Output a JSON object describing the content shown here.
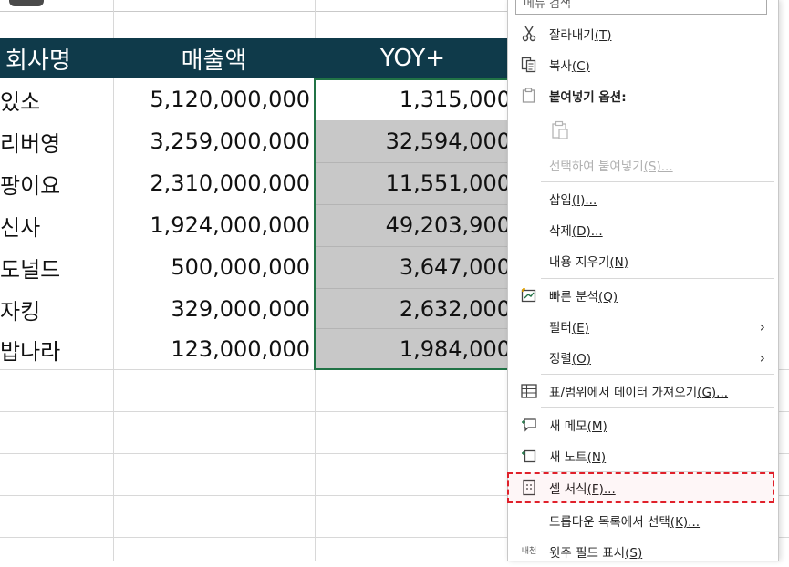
{
  "table": {
    "headers": [
      "회사명",
      "매출액",
      "YOY+"
    ],
    "rows": [
      {
        "name": "있소",
        "sales": "5,120,000,000",
        "yoy": "1,315,000"
      },
      {
        "name": "리버영",
        "sales": "3,259,000,000",
        "yoy": "32,594,000"
      },
      {
        "name": "팡이요",
        "sales": "2,310,000,000",
        "yoy": "11,551,000"
      },
      {
        "name": "신사",
        "sales": "1,924,000,000",
        "yoy": "49,203,900"
      },
      {
        "name": "도널드",
        "sales": "500,000,000",
        "yoy": "3,647,000"
      },
      {
        "name": "자킹",
        "sales": "329,000,000",
        "yoy": "2,632,000"
      },
      {
        "name": "밥나라",
        "sales": "123,000,000",
        "yoy": "1,984,000"
      }
    ]
  },
  "context_menu": {
    "search_placeholder": "메뉴 검색",
    "items": {
      "cut": {
        "label": "잘라내기",
        "key": "(T)"
      },
      "copy": {
        "label": "복사",
        "key": "(C)"
      },
      "paste_options": {
        "label": "붙여넣기 옵션:"
      },
      "paste_special": {
        "label": "선택하여 붙여넣기",
        "key": "(S)..."
      },
      "insert": {
        "label": "삽입",
        "key": "(I)..."
      },
      "delete": {
        "label": "삭제",
        "key": "(D)..."
      },
      "clear": {
        "label": "내용 지우기",
        "key": "(N)"
      },
      "quick_analysis": {
        "label": "빠른 분석",
        "key": "(Q)"
      },
      "filter": {
        "label": "필터",
        "key": "(E)"
      },
      "sort": {
        "label": "정렬",
        "key": "(O)"
      },
      "get_data": {
        "label": "표/범위에서 데이터 가져오기",
        "key": "(G)..."
      },
      "new_comment": {
        "label": "새 메모",
        "key": "(M)"
      },
      "new_note": {
        "label": "새 노트",
        "key": "(N)"
      },
      "format_cells": {
        "label": "셀 서식",
        "key": "(F)..."
      },
      "dropdown_pick": {
        "label": "드롭다운 목록에서 선택",
        "key": "(K)..."
      },
      "phonetic": {
        "label": "윗주 필드 표시",
        "key": "(S)",
        "icon_text": "내천"
      }
    }
  },
  "colors": {
    "header_bg": "#0f3a4a",
    "selected_fill": "#c8c8c8",
    "selection_border": "#217346",
    "highlight_dashed": "#e0202a"
  }
}
